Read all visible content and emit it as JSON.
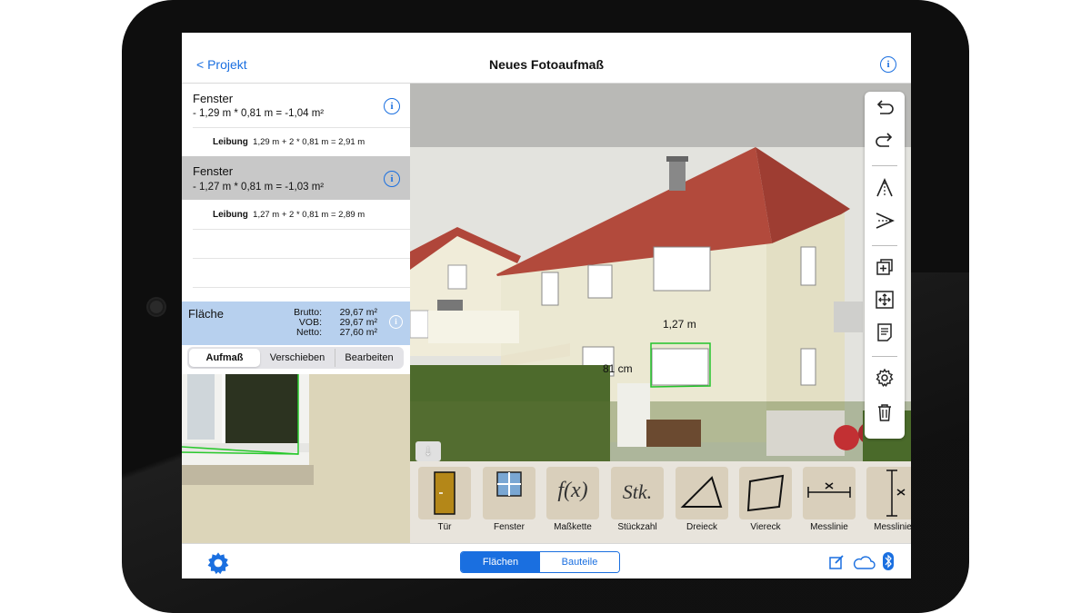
{
  "nav": {
    "back_label": "< Projekt",
    "title": "Neues Fotoaufmaß"
  },
  "list": {
    "items": [
      {
        "title": "Fenster",
        "formula": "- 1,29 m * 0,81 m = -1,04 m²",
        "sub_label": "Leibung",
        "sub_formula": "1,29 m + 2 * 0,81 m = 2,91 m"
      },
      {
        "title": "Fenster",
        "formula": "- 1,27 m * 0,81 m = -1,03 m²",
        "sub_label": "Leibung",
        "sub_formula": "1,27 m + 2 * 0,81 m = 2,89 m"
      }
    ],
    "selected_index": 1
  },
  "flaeche": {
    "title": "Fläche",
    "brutto_label": "Brutto:",
    "brutto_value": "29,67 m²",
    "vob_label": "VOB:",
    "vob_value": "29,67 m²",
    "netto_label": "Netto:",
    "netto_value": "27,60 m²"
  },
  "mode_tabs": [
    "Aufmaß",
    "Verschieben",
    "Bearbeiten"
  ],
  "mode_selected": "Aufmaß",
  "photo_labels": {
    "width": "1,27 m",
    "height": "81 cm"
  },
  "toolbar_icons": [
    "undo-icon",
    "redo-icon",
    "vertical-perspective-icon",
    "horizontal-perspective-icon",
    "add-layer-icon",
    "move-icon",
    "notes-icon",
    "settings-icon",
    "trash-icon"
  ],
  "tools": [
    {
      "label": "Tür",
      "icon": "door-icon"
    },
    {
      "label": "Fenster",
      "icon": "window-icon"
    },
    {
      "label": "Maßkette",
      "icon": "function-icon",
      "glyph": "f(x)"
    },
    {
      "label": "Stückzahl",
      "icon": "count-icon",
      "glyph": "Stk."
    },
    {
      "label": "Dreieck",
      "icon": "triangle-icon"
    },
    {
      "label": "Viereck",
      "icon": "quadrilateral-icon"
    },
    {
      "label": "Messlinie",
      "icon": "measure-line-icon"
    },
    {
      "label": "Messlinie",
      "icon": "measure-line-vertical-icon"
    }
  ],
  "bottom": {
    "tabs": [
      "Flächen",
      "Bauteile"
    ],
    "selected": "Flächen"
  },
  "colors": {
    "accent": "#1a6fe0",
    "selection": "#c8c8c8",
    "flaeche_bg": "#b7d0ee"
  }
}
